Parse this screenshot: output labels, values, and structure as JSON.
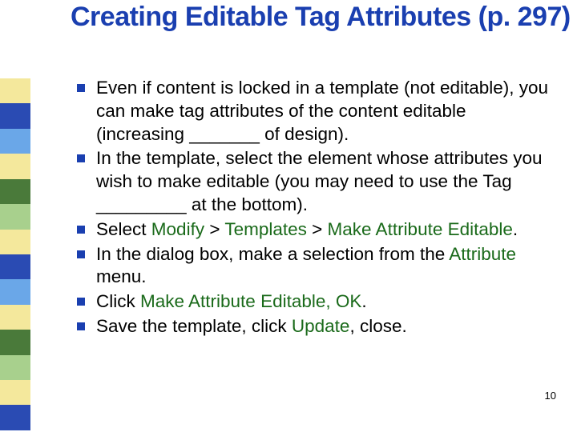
{
  "title": "Creating Editable Tag Attributes (p. 297)",
  "bullets": [
    {
      "pre": "Even if content is locked in a template (not editable), you can make tag attributes of the content editable (increasing _______ of design)."
    },
    {
      "pre": "In the template, select the element whose attributes you wish to make editable (you may need to use the Tag _________ at the bottom)."
    },
    {
      "pre": "Select ",
      "h1": "Modify",
      "m1": " > ",
      "h2": "Templates",
      "m2": " > ",
      "h3": "Make Attribute Editable",
      "post": "."
    },
    {
      "pre": "In the dialog box, make a selection from the ",
      "h1": "Attribute",
      "post": " menu."
    },
    {
      "pre": "Click ",
      "h1": "Make Attribute Editable, OK",
      "post": "."
    },
    {
      "pre": "Save the template, click ",
      "h1": "Update",
      "post": ", close."
    }
  ],
  "pagenum": "10"
}
